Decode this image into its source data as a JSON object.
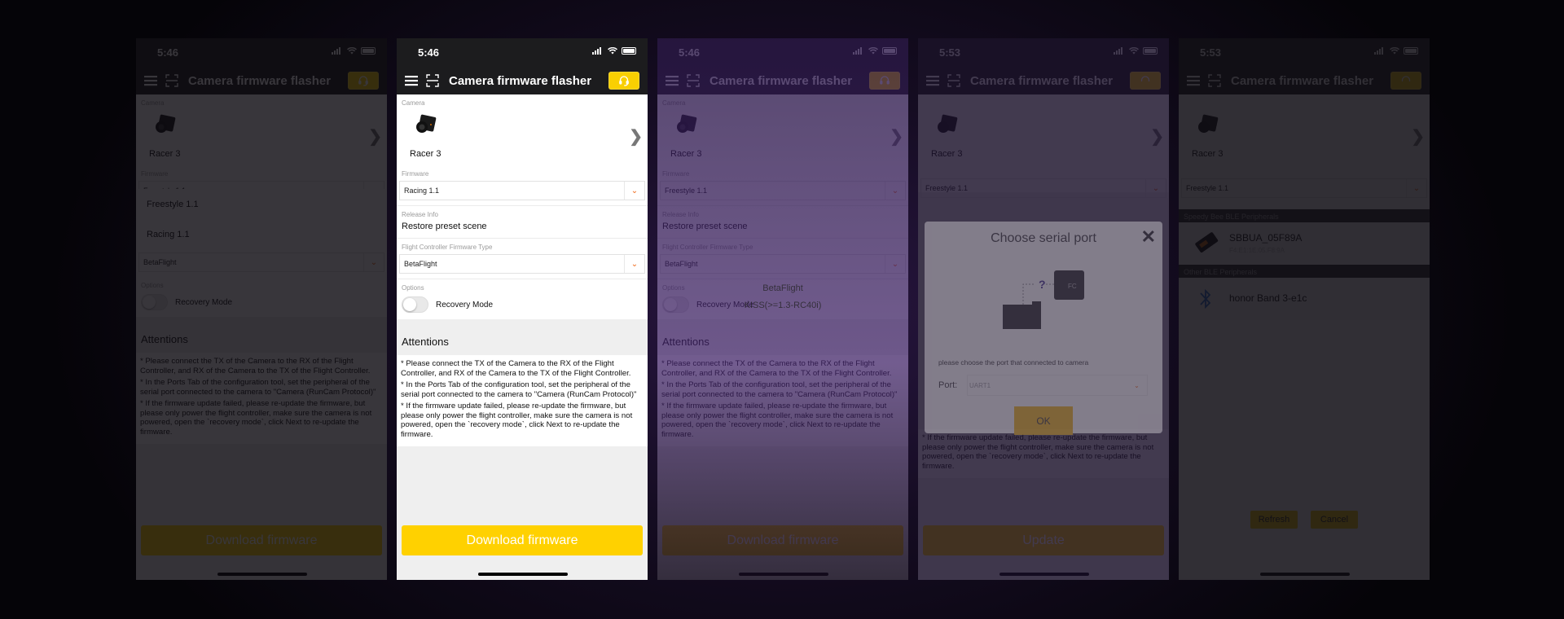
{
  "app": {
    "title": "Camera firmware flasher",
    "accent_color": "#ffd100",
    "chevron_color": "#f06a1a"
  },
  "screens": [
    {
      "time": "5:46",
      "state": "firmware-dropdown-open",
      "camera_label": "Camera",
      "camera_name": "Racer 3",
      "firmware_label": "Firmware",
      "firmware_value": "Freestyle 1.1",
      "firmware_options": [
        "Freestyle 1.1",
        "Racing 1.1"
      ],
      "fc_type_value": "BetaFlight",
      "options_label": "Options",
      "recovery_label": "Recovery Mode",
      "attentions_title": "Attentions",
      "attentions": [
        "* Please connect the TX of the Camera to the RX of the Flight Controller, and RX of the Camera to the TX of the Flight Controller.",
        "* In the Ports Tab of the configuration tool, set the peripheral of the serial port connected to the camera to \"Camera (RunCam Protocol)\"",
        "* If the firmware update failed, please re-update the firmware, but please only power the flight controller, make sure the camera is not powered, open the `recovery mode`, click Next to re-update the firmware."
      ],
      "button_label": "Download firmware"
    },
    {
      "time": "5:46",
      "state": "active",
      "camera_label": "Camera",
      "camera_name": "Racer 3",
      "firmware_label": "Firmware",
      "firmware_value": "Racing 1.1",
      "release_label": "Release Info",
      "release_value": "Restore preset scene",
      "fc_type_label": "Flight Controller Firmware Type",
      "fc_type_value": "BetaFlight",
      "options_label": "Options",
      "recovery_label": "Recovery Mode",
      "recovery_enabled": false,
      "attentions_title": "Attentions",
      "attentions": [
        "* Please connect the TX of the Camera to the RX of the Flight Controller, and RX of the Camera to the TX of the Flight Controller.",
        "* In the Ports Tab of the configuration tool, set the peripheral of the serial port connected to the camera to \"Camera (RunCam Protocol)\"",
        "* If the firmware update failed, please re-update the firmware, but please only power the flight controller, make sure the camera is not powered, open the `recovery mode`, click Next to re-update the firmware."
      ],
      "button_label": "Download firmware"
    },
    {
      "time": "5:46",
      "state": "fc-type-picker-open",
      "camera_label": "Camera",
      "camera_name": "Racer 3",
      "firmware_label": "Firmware",
      "firmware_value": "Freestyle 1.1",
      "release_label": "Release Info",
      "release_value": "Restore preset scene",
      "fc_type_label": "Flight Controller Firmware Type",
      "fc_type_value": "BetaFlight",
      "fc_type_options": [
        "BetaFlight",
        "KISS(>=1.3-RC40i)"
      ],
      "options_label": "Options",
      "recovery_label": "Recovery Mode",
      "attentions_title": "Attentions",
      "attentions": [
        "* Please connect the TX of the Camera to the RX of the Flight Controller, and RX of the Camera to the TX of the Flight Controller.",
        "* In the Ports Tab of the configuration tool, set the peripheral of the serial port connected to the camera to \"Camera (RunCam Protocol)\"",
        "* If the firmware update failed, please re-update the firmware, but please only power the flight controller, make sure the camera is not powered, open the `recovery mode`, click Next to re-update the firmware."
      ],
      "button_label": "Download firmware"
    },
    {
      "time": "5:53",
      "state": "serial-port-dialog",
      "camera_name": "Racer 3",
      "firmware_value": "Freestyle 1.1",
      "attentions": [
        "* If the firmware update failed, please re-update the firmware, but please only power the flight controller, make sure the camera is not powered, open the `recovery mode`, click Next to re-update the firmware."
      ],
      "dialog": {
        "title": "Choose serial port",
        "illustration_label": "FC",
        "question": "?",
        "message": "please choose the port that connected to camera",
        "port_label": "Port:",
        "port_value": "UART1",
        "ok_label": "OK"
      },
      "button_label": "Update"
    },
    {
      "time": "5:53",
      "state": "ble-peripherals",
      "camera_name": "Racer 3",
      "firmware_value": "Freestyle 1.1",
      "ble": {
        "speedybee_header": "Speedy Bee BLE Peripherals",
        "speedybee_devices": [
          {
            "name": "SBBUA_05F89A",
            "mac": "F4:E1:1E:05:F8:9A"
          }
        ],
        "other_header": "Other BLE Peripherals",
        "other_devices": [
          {
            "name": "honor Band 3-e1c"
          }
        ],
        "refresh_label": "Refresh",
        "cancel_label": "Cancel"
      }
    }
  ]
}
